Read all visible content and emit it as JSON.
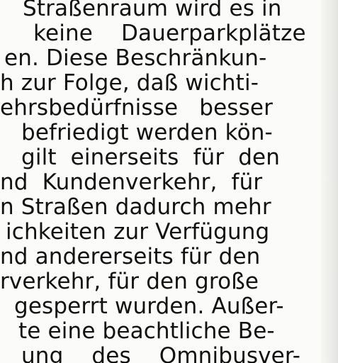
{
  "document": {
    "lines": [
      "Straßenraum wird es in",
      "keine Dauerparkplätze",
      "en. Diese Beschränkun-",
      "h zur Folge, daß wichti-",
      "ehrsbedürfnisse besser",
      "befriedigt werden kön-",
      "gilt einerseits für den",
      "nd Kundenverkehr, für",
      "n Straßen dadurch mehr",
      "ichkeiten zur Verfügung",
      "nd andererseits für den",
      "rverkehr, für den große",
      "gesperrt wurden. Außer-",
      "te eine beachtliche Be-",
      "ung des Omnibusver-"
    ]
  }
}
